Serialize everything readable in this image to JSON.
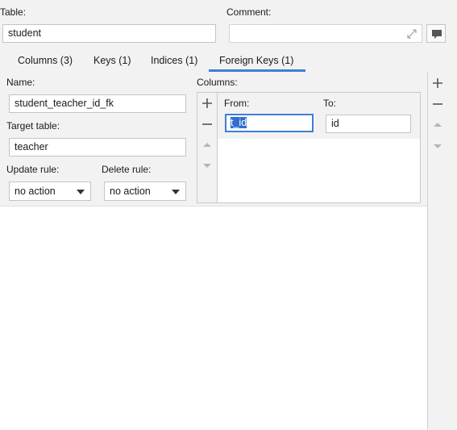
{
  "header": {
    "table_label": "Table:",
    "table_value": "student",
    "comment_label": "Comment:",
    "comment_value": ""
  },
  "tabs": [
    {
      "label": "Columns (3)"
    },
    {
      "label": "Keys (1)"
    },
    {
      "label": "Indices (1)"
    },
    {
      "label": "Foreign Keys (1)",
      "active": true
    }
  ],
  "fk": {
    "name_label": "Name:",
    "name_value": "student_teacher_id_fk",
    "target_label": "Target table:",
    "target_value": "teacher",
    "update_label": "Update rule:",
    "update_value": "no action",
    "delete_label": "Delete rule:",
    "delete_value": "no action"
  },
  "columns": {
    "label": "Columns:",
    "from_label": "From:",
    "to_label": "To:",
    "from_value": "t_id",
    "to_value": "id"
  },
  "colors": {
    "accent": "#3d7fd6",
    "selection": "#2f6fd0"
  }
}
